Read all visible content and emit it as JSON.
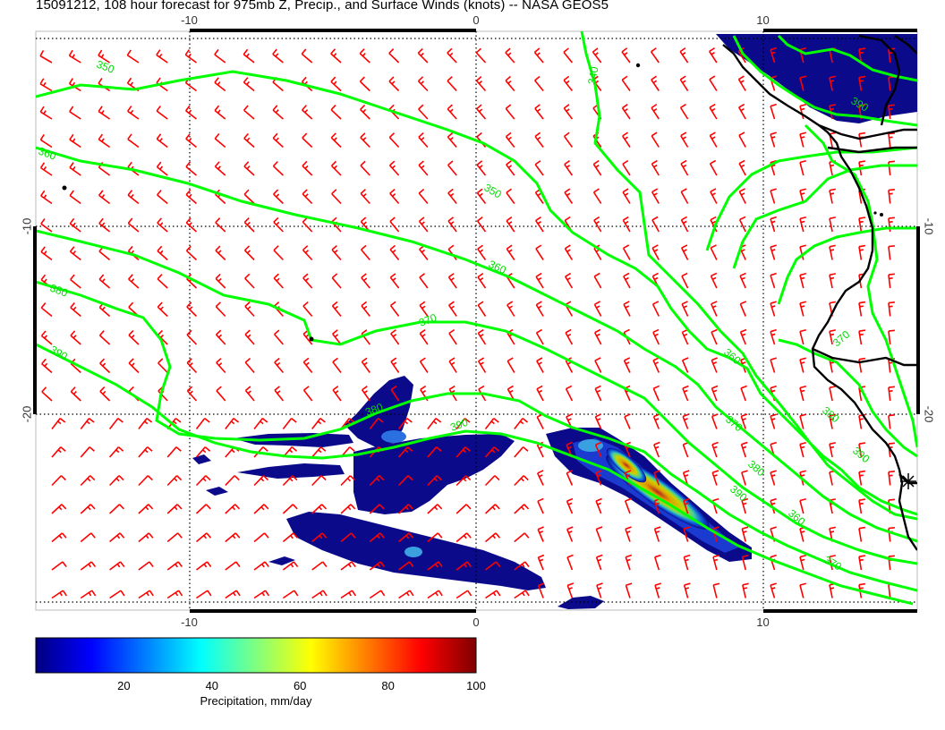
{
  "title": "15091212, 108 hour forecast for 975mb Z, Precip., and Surface Winds (knots) -- NASA GEOS5",
  "map": {
    "x_axis": {
      "ticks": [
        -10,
        0,
        10
      ]
    },
    "y_axis": {
      "ticks": [
        -10,
        -20
      ]
    },
    "wind_barb_color": "#ff0000",
    "contour_color": "#00ff00",
    "coastline_color": "#000000",
    "contour_labels": [
      "350",
      "340",
      "350",
      "360",
      "360",
      "370",
      "380",
      "390",
      "380",
      "390",
      "360",
      "370",
      "380",
      "390",
      "360",
      "370",
      "380",
      "390",
      "370",
      "390"
    ]
  },
  "colorbar": {
    "label": "Precipitation, mm/day",
    "ticks": [
      20,
      40,
      60,
      80,
      100
    ],
    "range": [
      0,
      100
    ],
    "colors": [
      "#00007f",
      "#0000ff",
      "#007fff",
      "#00ffff",
      "#7fff7f",
      "#ffff00",
      "#ff7f00",
      "#ff0000",
      "#7f0000"
    ]
  }
}
